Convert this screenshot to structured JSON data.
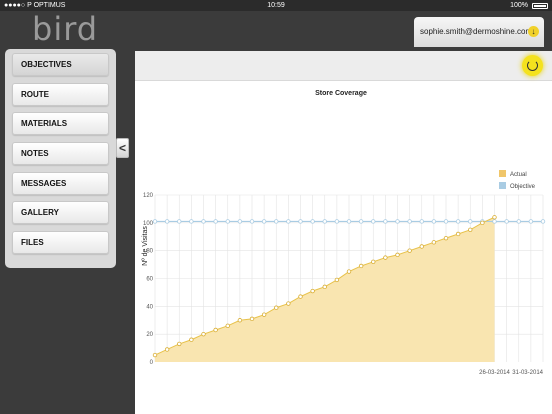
{
  "status_bar": {
    "carrier": "●●●●○ P OPTIMUS",
    "time": "10:59",
    "battery": "100%"
  },
  "app": {
    "logo": "bird"
  },
  "user": {
    "email": "sophie.smith@dermoshine.com",
    "download_icon": "down-arrow-icon"
  },
  "sidebar": {
    "items": [
      {
        "label": "OBJECTIVES"
      },
      {
        "label": "ROUTE"
      },
      {
        "label": "MATERIALS"
      },
      {
        "label": "NOTES"
      },
      {
        "label": "MESSAGES"
      },
      {
        "label": "GALLERY"
      },
      {
        "label": "FILES"
      }
    ],
    "collapse_label": "<"
  },
  "colors": {
    "actual": "#f0d060",
    "actual_fill": "#f9e5b0",
    "objective": "#a9cce3",
    "accent": "#f4e21e"
  },
  "chart_data": {
    "type": "area",
    "title": "Store Coverage",
    "ylabel": "Nº de Visitas",
    "xlabel": "",
    "ylim": [
      0,
      120
    ],
    "yticks": [
      0,
      20,
      40,
      60,
      80,
      100,
      120
    ],
    "x_tick_labels": [
      "26-03-2014",
      "31-03-2014"
    ],
    "legend": {
      "position": "top-right",
      "items": [
        "Actual",
        "Objective"
      ]
    },
    "grid": true,
    "series": [
      {
        "name": "Actual",
        "values": [
          5,
          9,
          13,
          16,
          20,
          23,
          26,
          30,
          31,
          34,
          39,
          42,
          47,
          51,
          54,
          59,
          65,
          69,
          72,
          75,
          77,
          80,
          83,
          86,
          89,
          92,
          95,
          100,
          104
        ]
      },
      {
        "name": "Objective",
        "values": [
          101,
          101,
          101,
          101,
          101,
          101,
          101,
          101,
          101,
          101,
          101,
          101,
          101,
          101,
          101,
          101,
          101,
          101,
          101,
          101,
          101,
          101,
          101,
          101,
          101,
          101,
          101,
          101,
          101,
          101,
          101,
          101,
          101
        ]
      }
    ]
  }
}
